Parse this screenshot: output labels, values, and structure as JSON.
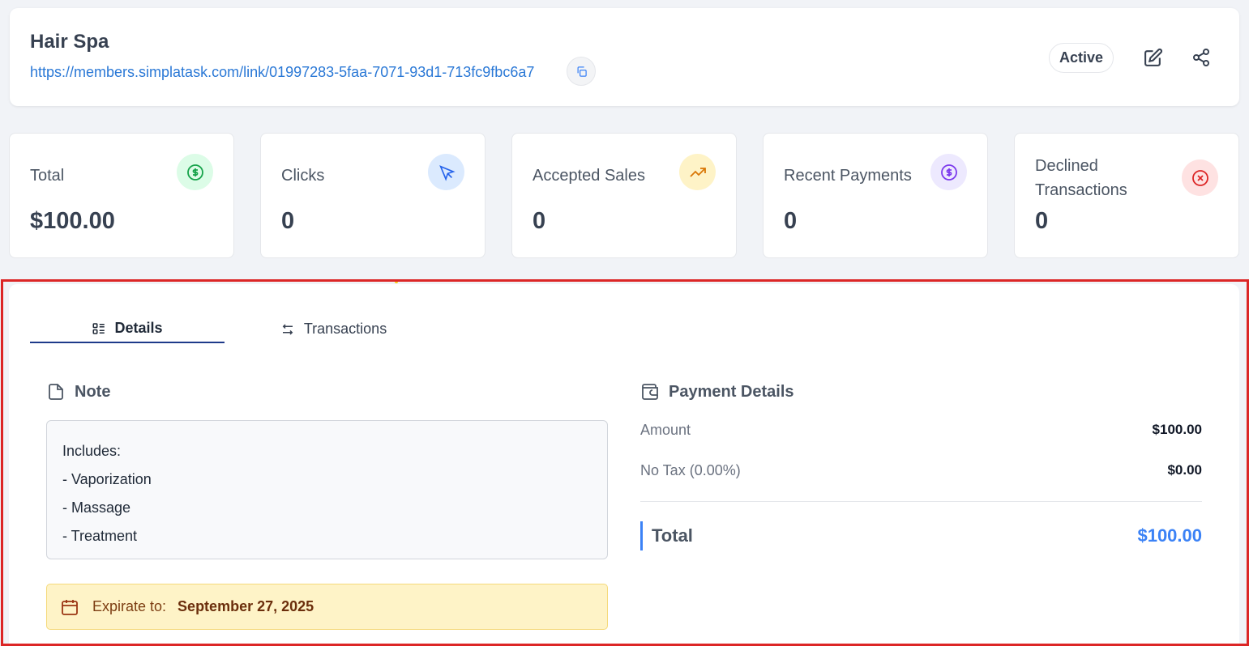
{
  "header": {
    "title": "Hair Spa",
    "link": "https://members.simplatask.com/link/01997283-5faa-7071-93d1-713fc9fbc6a7",
    "status": "Active"
  },
  "stats": [
    {
      "label": "Total",
      "value": "$100.00",
      "icon": "dollar-badge-icon",
      "color": "#16a34a",
      "bg": "#dcfce7"
    },
    {
      "label": "Clicks",
      "value": "0",
      "icon": "cursor-icon",
      "color": "#2563eb",
      "bg": "#dbeafe"
    },
    {
      "label": "Accepted Sales",
      "value": "0",
      "icon": "trending-up-icon",
      "color": "#d97706",
      "bg": "#fef3c7"
    },
    {
      "label": "Recent Payments",
      "value": "0",
      "icon": "dollar-badge-icon",
      "color": "#7c3aed",
      "bg": "#ede9fe"
    },
    {
      "label": "Declined Transactions",
      "value": "0",
      "icon": "x-circle-icon",
      "color": "#dc2626",
      "bg": "#fee2e2"
    }
  ],
  "tabs": {
    "details": "Details",
    "transactions": "Transactions"
  },
  "note": {
    "title": "Note",
    "lines": [
      "Includes:",
      "- Vaporization",
      "- Massage",
      "- Treatment"
    ]
  },
  "expiry": {
    "label": "Expirate to:",
    "date": "September 27, 2025"
  },
  "payment": {
    "title": "Payment Details",
    "amount_label": "Amount",
    "amount_value": "$100.00",
    "tax_label": "No Tax (0.00%)",
    "tax_value": "$0.00",
    "total_label": "Total",
    "total_value": "$100.00"
  }
}
